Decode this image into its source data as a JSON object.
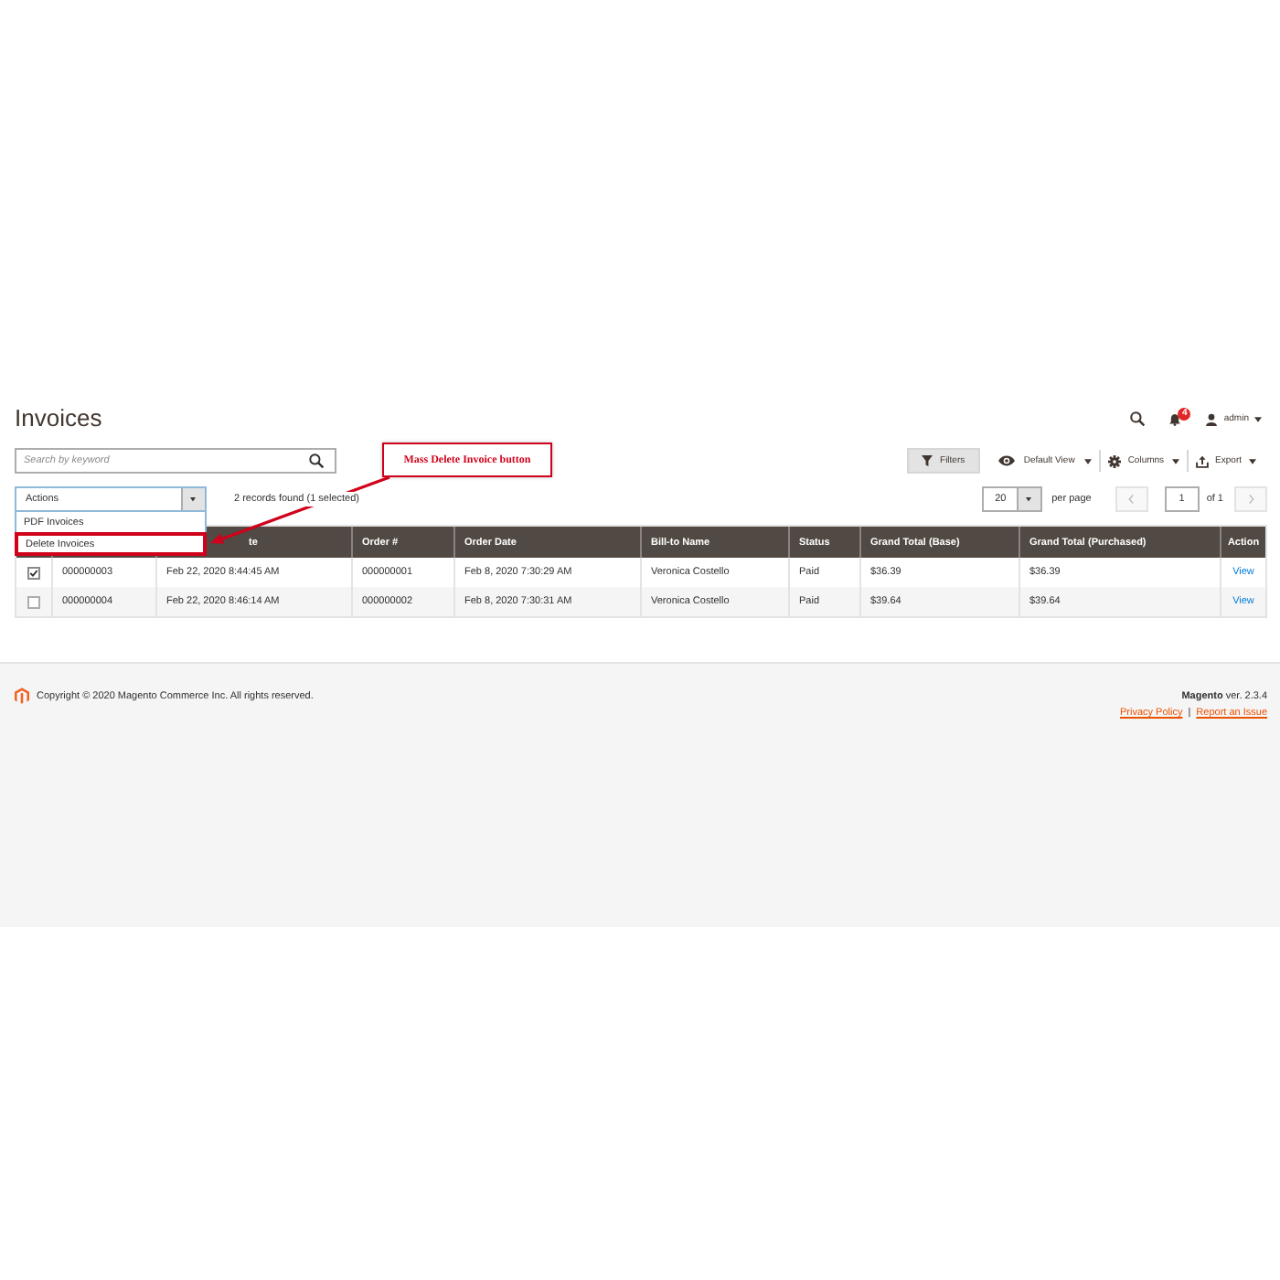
{
  "page": {
    "title": "Invoices"
  },
  "header": {
    "notification_count": "4",
    "user": "admin"
  },
  "search": {
    "placeholder": "Search by keyword"
  },
  "annotation": {
    "text": "Mass Delete Invoice button"
  },
  "toolbar": {
    "filters": "Filters",
    "view": "Default View",
    "columns": "Columns",
    "export": "Export"
  },
  "actions": {
    "label": "Actions",
    "expanded": true,
    "options": [
      {
        "label": "PDF Invoices",
        "highlighted": false
      },
      {
        "label": "Delete Invoices",
        "highlighted": true
      }
    ]
  },
  "records": "2 records found (1 selected)",
  "pagination": {
    "per_page": "20",
    "per_page_label": "per page",
    "page": "1",
    "total": "of 1"
  },
  "table": {
    "columns": [
      {},
      {
        "label": "te"
      },
      {
        "label": "Order #"
      },
      {
        "label": "Order Date"
      },
      {
        "label": "Bill-to Name"
      },
      {
        "label": "Status"
      },
      {
        "label": "Grand Total (Base)"
      },
      {
        "label": "Grand Total (Purchased)"
      },
      {
        "label": "Action"
      }
    ],
    "rows": [
      {
        "checked": true,
        "cells": [
          "000000003",
          "Feb 22, 2020 8:44:45 AM",
          "000000001",
          "Feb 8, 2020 7:30:29 AM",
          "Veronica Costello",
          "Paid",
          "$36.39",
          "$36.39",
          "View"
        ]
      },
      {
        "checked": false,
        "cells": [
          "000000004",
          "Feb 22, 2020 8:46:14 AM",
          "000000002",
          "Feb 8, 2020 7:30:31 AM",
          "Veronica Costello",
          "Paid",
          "$39.64",
          "$39.64",
          "View"
        ]
      }
    ]
  },
  "footer": {
    "copyright": "Copyright © 2020 Magento Commerce Inc. All rights reserved.",
    "version": "**Magento** ver. 2.3.4",
    "links": [
      "Privacy Policy",
      "Report an Issue"
    ],
    "separator": "|"
  }
}
